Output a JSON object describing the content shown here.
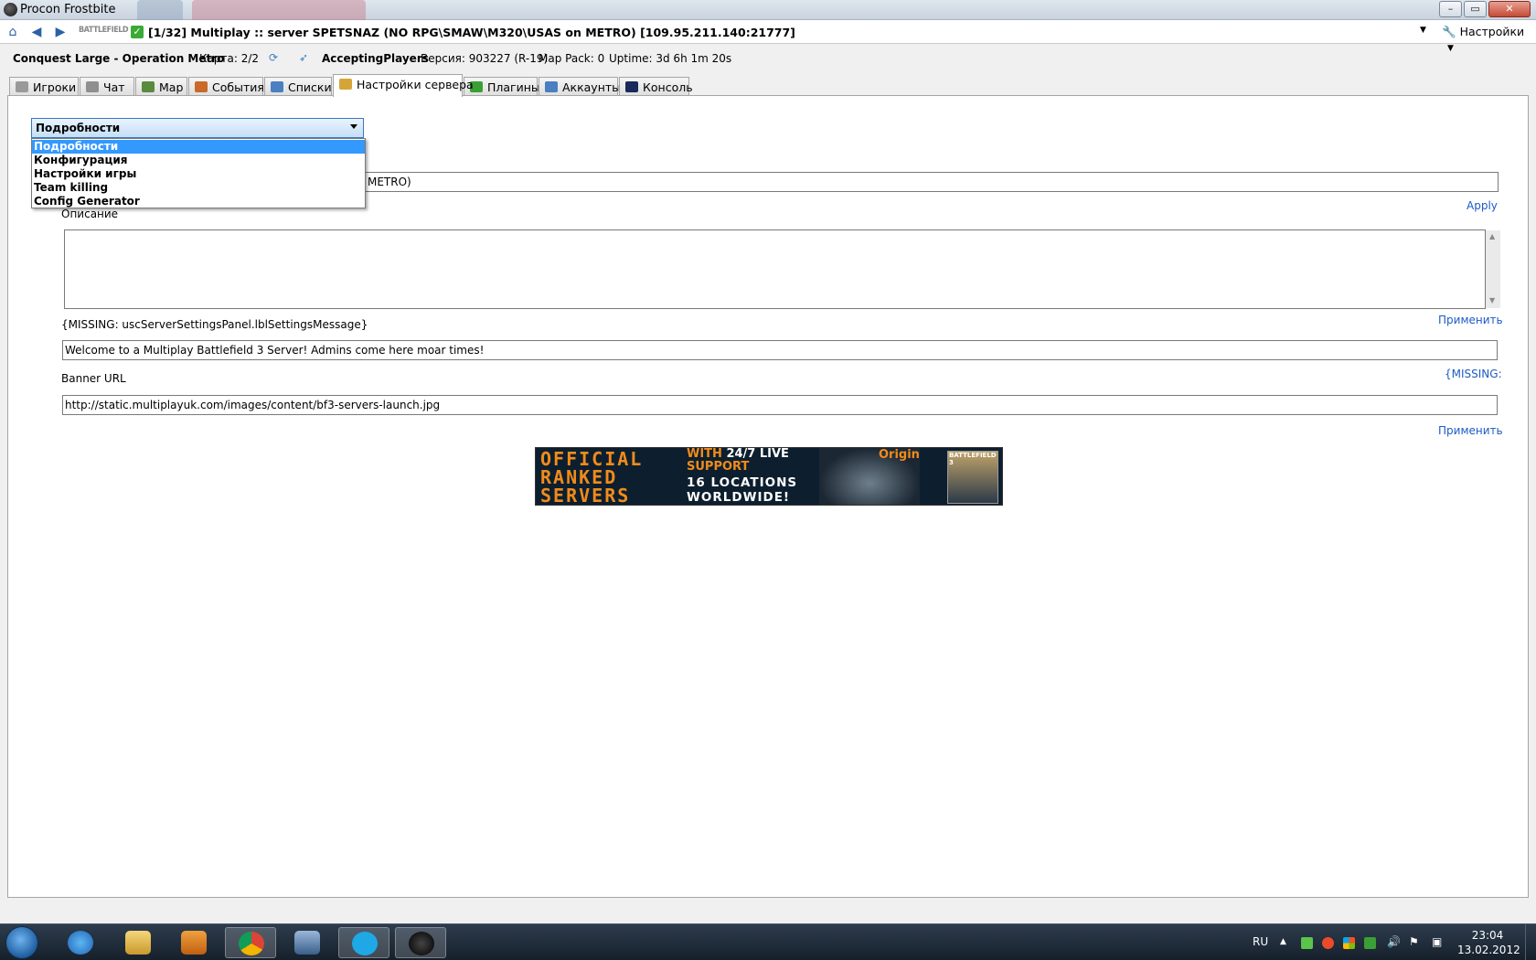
{
  "window": {
    "title": "Procon Frostbite",
    "minimize": "–",
    "maximize": "▭",
    "close": "✕"
  },
  "nav": {
    "game_logo": "BATTLEFIELD 3",
    "server_title": "[1/32] Multiplay :: server SPETSNAZ (NO RPG\\SMAW\\M320\\USAS on METRO) [109.95.211.140:21777]",
    "settings_label": "Настройки"
  },
  "status": {
    "map": "Conquest Large - Operation Metro",
    "round": "Карта: 2/2",
    "state": "AcceptingPlayers",
    "version": "Версия: 903227 (R-19)",
    "map_pack": "Map Pack: 0",
    "uptime": "Uptime: 3d 6h 1m 20s"
  },
  "tabs": [
    {
      "label": "Игроки",
      "icon": "players-icon",
      "color": "#9a9a9a"
    },
    {
      "label": "Чат",
      "icon": "chat-icon",
      "color": "#8f8f8f"
    },
    {
      "label": "Мар",
      "icon": "map-icon",
      "color": "#5a8a3c"
    },
    {
      "label": "События",
      "icon": "events-icon",
      "color": "#c96a2a"
    },
    {
      "label": "Списки",
      "icon": "lists-icon",
      "color": "#4a7fc1"
    },
    {
      "label": "Настройки сервера",
      "icon": "server-settings-icon",
      "color": "#d6a53a"
    },
    {
      "label": "Плагины",
      "icon": "plugins-icon",
      "color": "#3aa035"
    },
    {
      "label": "Аккаунты",
      "icon": "accounts-icon",
      "color": "#4a7fc1"
    },
    {
      "label": "Консоль",
      "icon": "console-icon",
      "color": "#1a2a5a"
    }
  ],
  "section_select": {
    "value": "Подробности",
    "options": [
      "Подробности",
      "Конфигурация",
      "Настройки игры",
      "Team killing",
      "Config Generator"
    ]
  },
  "details": {
    "server_name_tail": "METRO)",
    "apply_link": "Apply",
    "description_label": "Описание",
    "description_value": "",
    "message_label": "{MISSING: uscServerSettingsPanel.lblSettingsMessage}",
    "apply_link_ru": "Применить",
    "message_value": "Welcome to a Multiplay Battlefield 3 Server! Admins come here moar times!",
    "banner_label": "Banner URL",
    "missing_link": "{MISSING:",
    "banner_value": "http://static.multiplayuk.com/images/content/bf3-servers-launch.jpg",
    "apply_link_ru_2": "Применить"
  },
  "banner": {
    "line1": "OFFICIAL",
    "line2": "RANKED",
    "line3": "SERVERS",
    "with": "WITH",
    "live": "24/7 LIVE",
    "support": "SUPPORT",
    "locations": "16 LOCATIONS",
    "worldwide": "WORLDWIDE!",
    "origin": "Origin",
    "box": "BATTLEFIELD 3"
  },
  "taskbar": {
    "language": "RU",
    "time": "23:04",
    "date": "13.02.2012",
    "apps": [
      "ie-icon",
      "explorer-icon",
      "media-player-icon",
      "chrome-icon",
      "procon-icon",
      "skype-icon",
      "procon-frostbite-icon"
    ]
  }
}
